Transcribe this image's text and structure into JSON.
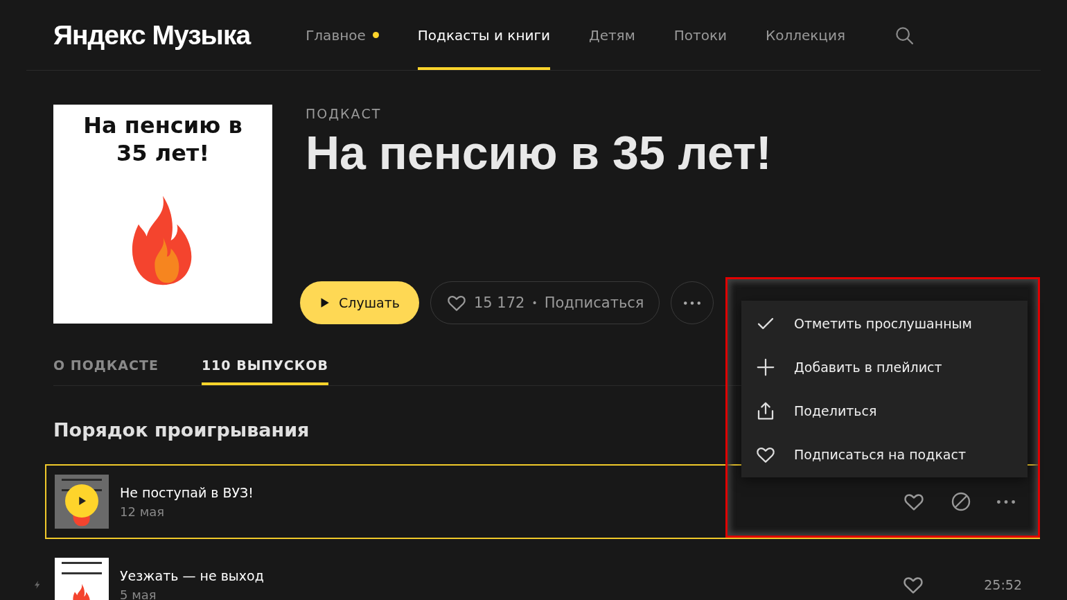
{
  "logo": "Яндекс Музыка",
  "nav": [
    {
      "label": "Главное",
      "selected": false,
      "dot": true
    },
    {
      "label": "Подкасты и книги",
      "selected": true,
      "dot": false
    },
    {
      "label": "Детям",
      "selected": false,
      "dot": false
    },
    {
      "label": "Потоки",
      "selected": false,
      "dot": false
    },
    {
      "label": "Коллекция",
      "selected": false,
      "dot": false
    }
  ],
  "podcast": {
    "cover_text": "На пенсию в 35 лет!",
    "type_label": "ПОДКАСТ",
    "title": "На пенсию в 35 лет!",
    "play_label": "Слушать",
    "likes": "15 172",
    "separator": "•",
    "subscribe_label": "Подписаться"
  },
  "tabs": [
    {
      "label": "О ПОДКАСТЕ",
      "selected": false
    },
    {
      "label": "110 ВЫПУСКОВ",
      "selected": true
    }
  ],
  "section_title": "Порядок проигрывания",
  "episodes": [
    {
      "title": "Не поступай в ВУЗ!",
      "date": "12 мая",
      "selected": true
    },
    {
      "title": "Уезжать — не выход",
      "date": "5 мая",
      "selected": false,
      "duration": "25:52"
    }
  ],
  "menu": {
    "items": [
      {
        "kind": "check",
        "label": "Отметить прослушанным"
      },
      {
        "kind": "plus",
        "label": "Добавить в плейлист"
      },
      {
        "kind": "share",
        "label": "Поделиться"
      },
      {
        "kind": "heart",
        "label": "Подписаться на подкаст"
      }
    ]
  },
  "annotation": {
    "kind": "rectangle",
    "color": "#e00000"
  }
}
